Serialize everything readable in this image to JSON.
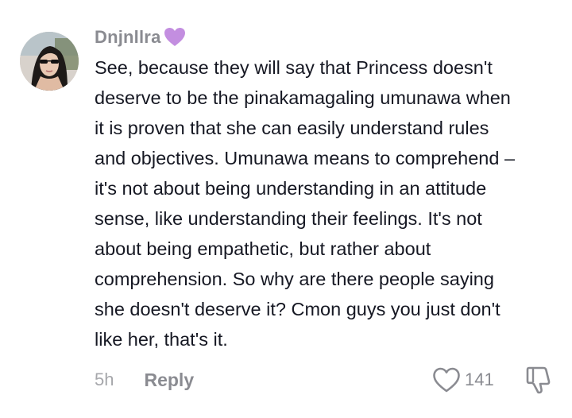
{
  "comment": {
    "username": "Dnjnllra",
    "username_emoji_icon": "purple-heart-icon",
    "text_lines": [
      "See, because they will say that Princess doesn't",
      "deserve to be the pinakamagaling umunawa when",
      "it is proven that she can easily understand rules",
      "and objectives. Umunawa means to comprehend –",
      "it's not about being understanding in an attitude",
      "sense, like understanding their feelings. It's not",
      "about being empathetic, but rather about",
      "comprehension. So why are there people saying",
      "she doesn't deserve it? Cmon guys you just don't",
      "like her, that's it."
    ],
    "timestamp": "5h",
    "reply_label": "Reply",
    "like_count": "141",
    "like_icon": "heart-outline-icon",
    "dislike_icon": "thumbs-down-icon"
  },
  "colors": {
    "username": "#8a8b91",
    "text": "#161823",
    "meta": "#a6a7ab",
    "emoji_purple": "#c38ee0"
  }
}
